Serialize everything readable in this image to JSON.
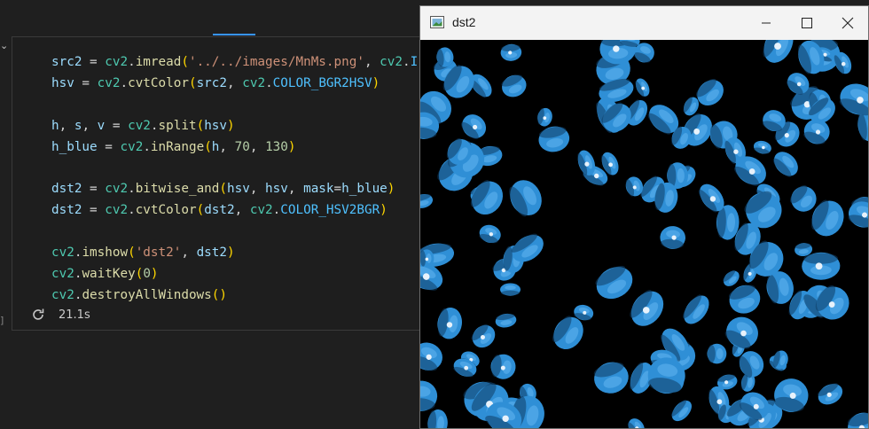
{
  "editor": {
    "code_lines": [
      [
        [
          "v",
          "src2"
        ],
        [
          "o",
          " = "
        ],
        [
          "m",
          "cv2"
        ],
        [
          "o",
          "."
        ],
        [
          "f",
          "imread"
        ],
        [
          "p",
          "("
        ],
        [
          "s",
          "'../../images/MnMs.png'"
        ],
        [
          "o",
          ", "
        ],
        [
          "m",
          "cv2"
        ],
        [
          "o",
          "."
        ],
        [
          "k",
          "I"
        ]
      ],
      [
        [
          "v",
          "hsv"
        ],
        [
          "o",
          " = "
        ],
        [
          "m",
          "cv2"
        ],
        [
          "o",
          "."
        ],
        [
          "f",
          "cvtColor"
        ],
        [
          "p",
          "("
        ],
        [
          "v",
          "src2"
        ],
        [
          "o",
          ", "
        ],
        [
          "m",
          "cv2"
        ],
        [
          "o",
          "."
        ],
        [
          "k",
          "COLOR_BGR2HSV"
        ],
        [
          "p",
          ")"
        ]
      ],
      [],
      [
        [
          "v",
          "h"
        ],
        [
          "o",
          ", "
        ],
        [
          "v",
          "s"
        ],
        [
          "o",
          ", "
        ],
        [
          "v",
          "v"
        ],
        [
          "o",
          " = "
        ],
        [
          "m",
          "cv2"
        ],
        [
          "o",
          "."
        ],
        [
          "f",
          "split"
        ],
        [
          "p",
          "("
        ],
        [
          "v",
          "hsv"
        ],
        [
          "p",
          ")"
        ]
      ],
      [
        [
          "v",
          "h_blue"
        ],
        [
          "o",
          " = "
        ],
        [
          "m",
          "cv2"
        ],
        [
          "o",
          "."
        ],
        [
          "f",
          "inRange"
        ],
        [
          "p",
          "("
        ],
        [
          "v",
          "h"
        ],
        [
          "o",
          ", "
        ],
        [
          "n",
          "70"
        ],
        [
          "o",
          ", "
        ],
        [
          "n",
          "130"
        ],
        [
          "p",
          ")"
        ]
      ],
      [],
      [
        [
          "v",
          "dst2"
        ],
        [
          "o",
          " = "
        ],
        [
          "m",
          "cv2"
        ],
        [
          "o",
          "."
        ],
        [
          "f",
          "bitwise_and"
        ],
        [
          "p",
          "("
        ],
        [
          "v",
          "hsv"
        ],
        [
          "o",
          ", "
        ],
        [
          "v",
          "hsv"
        ],
        [
          "o",
          ", "
        ],
        [
          "v",
          "mask"
        ],
        [
          "o",
          "="
        ],
        [
          "v",
          "h_blue"
        ],
        [
          "p",
          ")"
        ]
      ],
      [
        [
          "v",
          "dst2"
        ],
        [
          "o",
          " = "
        ],
        [
          "m",
          "cv2"
        ],
        [
          "o",
          "."
        ],
        [
          "f",
          "cvtColor"
        ],
        [
          "p",
          "("
        ],
        [
          "v",
          "dst2"
        ],
        [
          "o",
          ", "
        ],
        [
          "m",
          "cv2"
        ],
        [
          "o",
          "."
        ],
        [
          "k",
          "COLOR_HSV2BGR"
        ],
        [
          "p",
          ")"
        ]
      ],
      [],
      [
        [
          "m",
          "cv2"
        ],
        [
          "o",
          "."
        ],
        [
          "f",
          "imshow"
        ],
        [
          "p",
          "("
        ],
        [
          "s",
          "'dst2'"
        ],
        [
          "o",
          ", "
        ],
        [
          "v",
          "dst2"
        ],
        [
          "p",
          ")"
        ]
      ],
      [
        [
          "m",
          "cv2"
        ],
        [
          "o",
          "."
        ],
        [
          "f",
          "waitKey"
        ],
        [
          "p",
          "("
        ],
        [
          "n",
          "0"
        ],
        [
          "p",
          ")"
        ]
      ],
      [
        [
          "m",
          "cv2"
        ],
        [
          "o",
          "."
        ],
        [
          "f",
          "destroyAllWindows"
        ],
        [
          "p",
          "()"
        ]
      ]
    ],
    "exec_time": "21.1s",
    "exec_icon": "refresh-icon"
  },
  "window": {
    "title": "dst2",
    "app_icon": "image-window-icon",
    "buttons": [
      "minimize-icon",
      "maximize-icon",
      "close-icon"
    ],
    "image_description_colors": {
      "background": "#000000",
      "candy": "#2f8fd6"
    }
  }
}
